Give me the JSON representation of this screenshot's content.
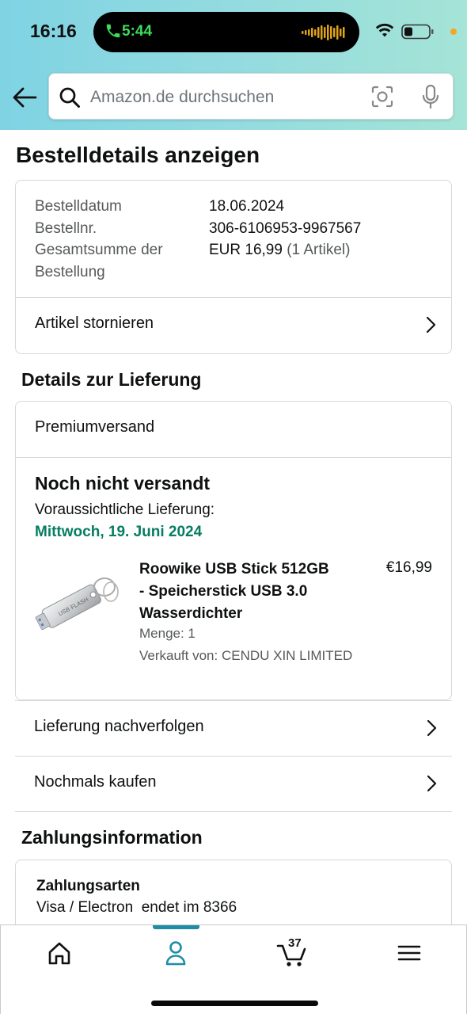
{
  "status_bar": {
    "time": "16:16",
    "call_time": "5:44"
  },
  "search": {
    "placeholder": "Amazon.de durchsuchen"
  },
  "page": {
    "title": "Bestelldetails anzeigen"
  },
  "order_summary": {
    "date_label": "Bestelldatum",
    "date_value": "18.06.2024",
    "number_label": "Bestellnr.",
    "number_value": "306-6106953-9967567",
    "total_label_line1": "Gesamtsumme der",
    "total_label_line2": "Bestellung",
    "total_value": "EUR 16,99",
    "total_items": "(1 Artikel)",
    "cancel_label": "Artikel stornieren"
  },
  "delivery": {
    "section_title": "Details zur Lieferung",
    "shipping_method": "Premiumversand",
    "status": "Noch nicht versandt",
    "estimate_label": "Voraussichtliche Lieferung:",
    "estimate_date": "Mittwoch, 19. Juni 2024",
    "product": {
      "title": "Roowike USB Stick 512GB - Speicherstick USB 3.0 Wasserdichter",
      "price": "€16,99",
      "quantity": "Menge: 1",
      "seller": "Verkauft von: CENDU XIN LIMITED",
      "image_text": "USB FLASH"
    }
  },
  "actions": {
    "track": "Lieferung nachverfolgen",
    "buy_again": "Nochmals kaufen"
  },
  "payment": {
    "section_title": "Zahlungsinformation",
    "heading": "Zahlungsarten",
    "method": "Visa / Electron  endet im 8366"
  },
  "bottom_nav": {
    "cart_count": "37",
    "active_tab": "account"
  },
  "colors": {
    "header_gradient_start": "#7fd3e3",
    "header_gradient_end": "#a5e4d6",
    "delivery_green": "#067d62",
    "nav_accent": "#1f8ca6"
  }
}
